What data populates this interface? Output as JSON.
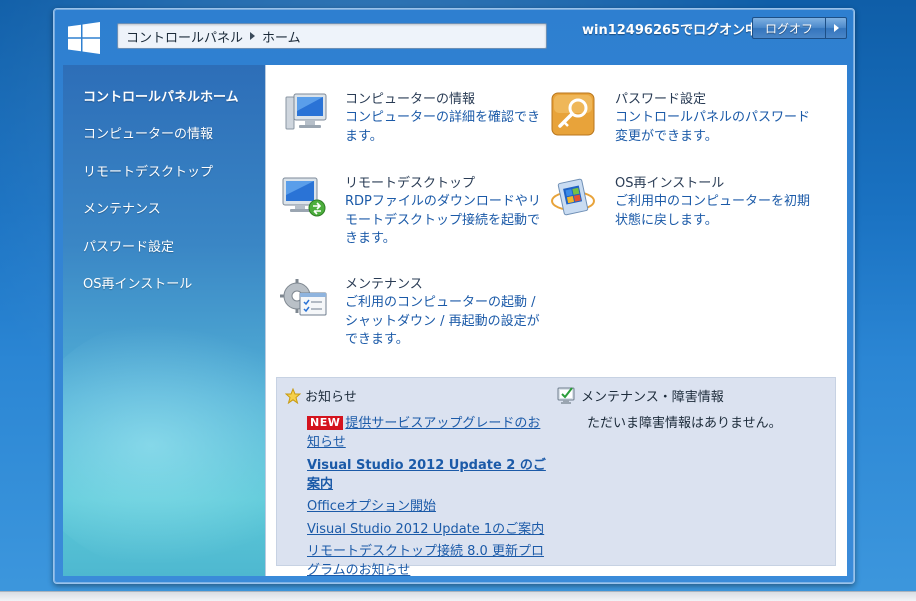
{
  "header": {
    "breadcrumb": [
      "コントロールパネル",
      "ホーム"
    ],
    "login_status": "win12496265でログオン中",
    "logout_label": "ログオフ"
  },
  "sidebar": {
    "items": [
      {
        "label": "コントロールパネルホーム",
        "active": true
      },
      {
        "label": "コンピューターの情報",
        "active": false
      },
      {
        "label": "リモートデスクトップ",
        "active": false
      },
      {
        "label": "メンテナンス",
        "active": false
      },
      {
        "label": "パスワード設定",
        "active": false
      },
      {
        "label": "OS再インストール",
        "active": false
      }
    ]
  },
  "main": {
    "items": [
      {
        "title": "コンピューターの情報",
        "desc": "コンピューターの詳細を確認できます。",
        "icon": "computer-info-icon"
      },
      {
        "title": "パスワード設定",
        "desc": "コントロールパネルのパスワード変更ができます。",
        "icon": "key-icon"
      },
      {
        "title": "リモートデスクトップ",
        "desc": "RDPファイルのダウンロードやリモートデスクトップ接続を起動できます。",
        "icon": "remote-desktop-icon"
      },
      {
        "title": "OS再インストール",
        "desc": "ご利用中のコンピューターを初期状態に戻します。",
        "icon": "os-reinstall-icon"
      },
      {
        "title": "メンテナンス",
        "desc": "ご利用のコンピューターの起動 / シャットダウン / 再起動の設定ができます。",
        "icon": "maintenance-icon"
      }
    ]
  },
  "news": {
    "heading": "お知らせ",
    "badge": "NEW",
    "items": [
      {
        "text": "提供サービスアップグレードのお知らせ",
        "bold": false,
        "new": true
      },
      {
        "text": "Visual Studio 2012 Update 2 のご案内",
        "bold": true,
        "new": false
      },
      {
        "text": "Officeオプション開始",
        "bold": false,
        "new": false
      },
      {
        "text": "Visual Studio 2012 Update 1のご案内",
        "bold": false,
        "new": false
      },
      {
        "text": "リモートデスクトップ接続 8.0 更新プログラムのお知らせ",
        "bold": false,
        "new": false
      }
    ]
  },
  "maintenance": {
    "heading": "メンテナンス・障害情報",
    "message": "ただいま障害情報はありません。"
  },
  "colors": {
    "accent": "#1b5aa8",
    "sidebar_top": "#2d6eb8",
    "news_bg": "#dbe2f0",
    "new_badge": "#d4131e"
  }
}
